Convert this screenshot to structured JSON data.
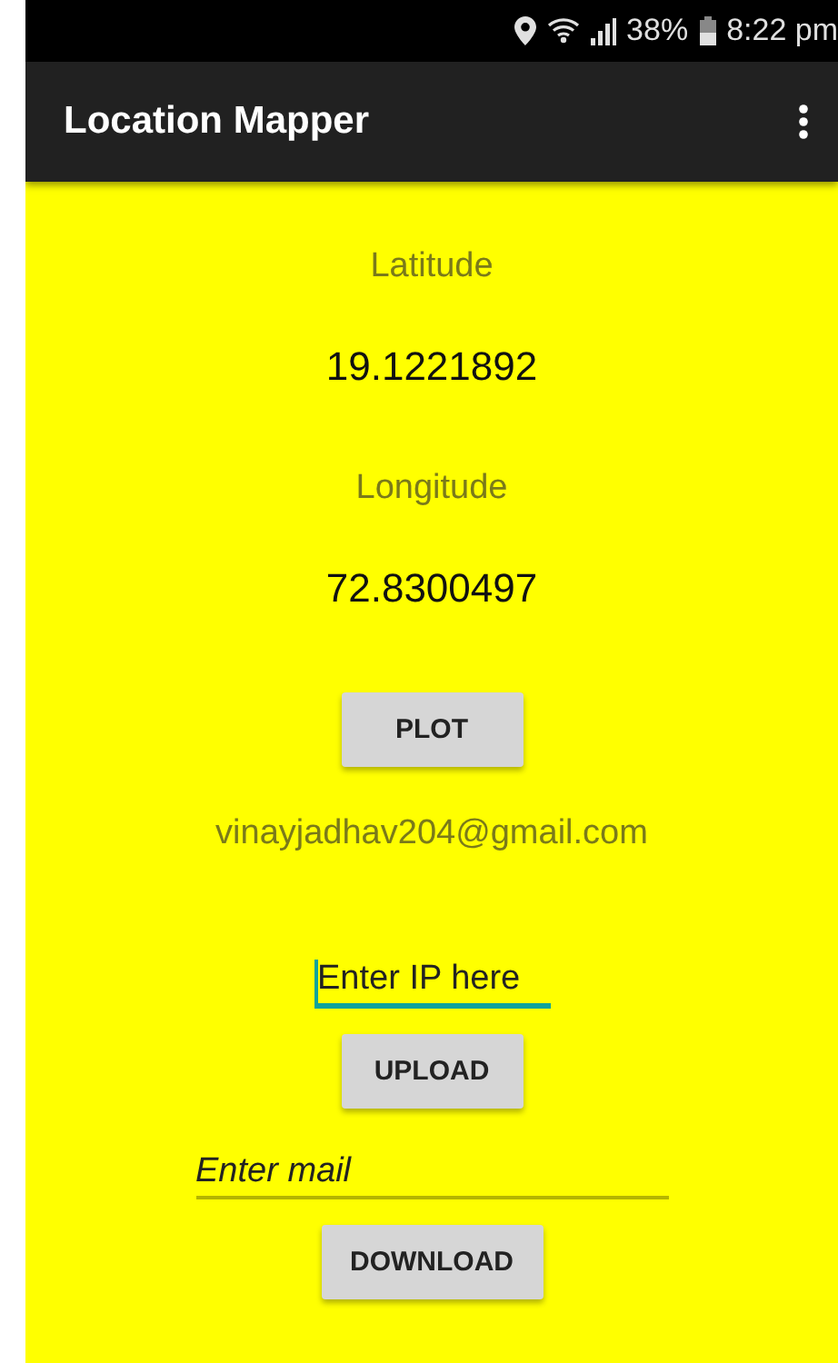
{
  "status_bar": {
    "battery": "38%",
    "time": "8:22 pm"
  },
  "app_bar": {
    "title": "Location Mapper"
  },
  "fields": [
    {
      "kind": "reading",
      "label": "Latitude",
      "value": "19.1221892"
    },
    {
      "kind": "reading",
      "label": "Longitude",
      "value": "72.8300497"
    },
    {
      "kind": "button",
      "label": "PLOT"
    },
    {
      "kind": "text",
      "text": "vinayjadhav204@gmail.com"
    },
    {
      "kind": "input",
      "placeholder": "Enter IP here",
      "focused": true,
      "italic": false
    },
    {
      "kind": "button",
      "label": "UPLOAD"
    },
    {
      "kind": "input",
      "placeholder": "Enter mail",
      "focused": false,
      "italic": true
    },
    {
      "kind": "button",
      "label": "DOWNLOAD"
    }
  ]
}
